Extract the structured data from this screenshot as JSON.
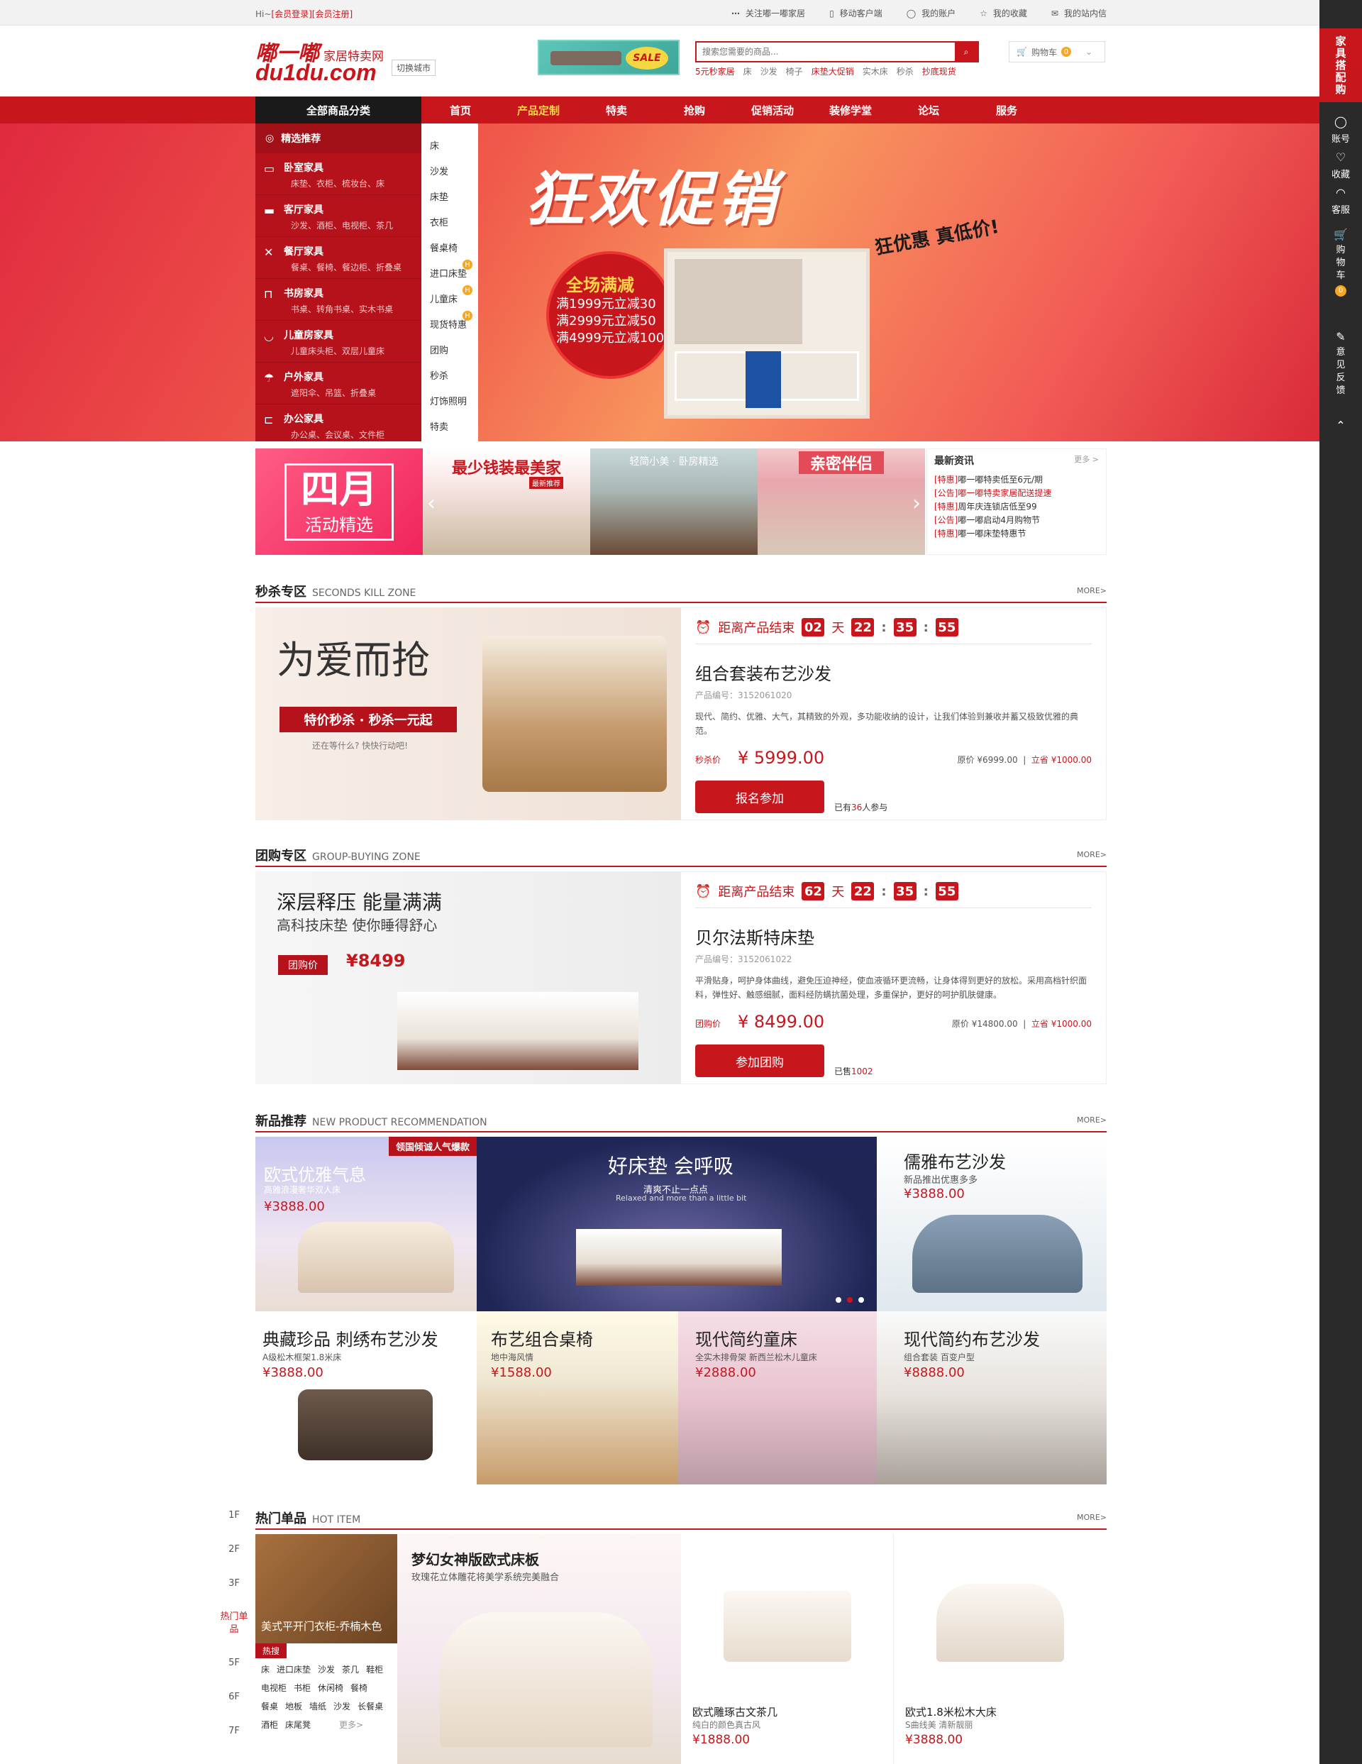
{
  "topbar": {
    "greeting_prefix": "Hi~",
    "login": "[会员登录]",
    "register": "[会员注册]",
    "links": [
      "关注嘟一嘟家居",
      "移动客户端",
      "我的账户",
      "我的收藏",
      "我的站内信"
    ]
  },
  "header": {
    "logo_cn": "嘟一嘟",
    "logo_site": "家居特卖网",
    "logo_domain": "du1du.com",
    "city_switch": "切换城市",
    "sale_badge": "SALE",
    "search_placeholder": "搜索您需要的商品...",
    "hot_words": [
      "5元秒家居",
      "床",
      "沙发",
      "椅子",
      "床垫大促销",
      "实木床",
      "秒杀",
      "抄底现货"
    ],
    "cart_label": "购物车",
    "cart_count": "0"
  },
  "nav": {
    "all_categories": "全部商品分类",
    "items": [
      "首页",
      "产品定制",
      "特卖",
      "抢购",
      "促销活动",
      "装修学堂",
      "论坛",
      "服务"
    ]
  },
  "categories": {
    "head": "精选推荐",
    "items": [
      {
        "title": "卧室家具",
        "sub": "床垫、衣柜、梳妆台、床"
      },
      {
        "title": "客厅家具",
        "sub": "沙发、酒柜、电视柜、茶几"
      },
      {
        "title": "餐厅家具",
        "sub": "餐桌、餐椅、餐边柜、折叠桌"
      },
      {
        "title": "书房家具",
        "sub": "书桌、转角书桌、实木书桌"
      },
      {
        "title": "儿童房家具",
        "sub": "儿童床头柜、双层儿童床"
      },
      {
        "title": "户外家具",
        "sub": "遮阳伞、吊篮、折叠桌"
      },
      {
        "title": "办公家具",
        "sub": "办公桌、会议桌、文件柜"
      }
    ],
    "sub_menu": [
      "床",
      "沙发",
      "床垫",
      "衣柜",
      "餐桌椅",
      "进口床垫",
      "儿童床",
      "现货特惠",
      "团购",
      "秒杀",
      "灯饰照明",
      "特卖"
    ]
  },
  "banner": {
    "title": "狂欢促销",
    "slogan": "狂优惠 真低价!",
    "promo_head": "全场满减",
    "promo_lines": [
      "满1999元立减30",
      "满2999元立减50",
      "满4999元立减100"
    ]
  },
  "sidebar": {
    "top": "家具搭配购",
    "items": [
      "账号",
      "收藏",
      "客服",
      "购物车",
      "意见反馈"
    ],
    "cart_count": "0"
  },
  "strip": {
    "april_month": "四月",
    "april_sub": "活动精选",
    "tile1": "最少钱装最美家",
    "tile1_tag": "最新推荐",
    "tile2": "轻简小美 · 卧房精选",
    "tile3": "亲密伴侣",
    "news_title": "最新资讯",
    "news_more": "更多 >",
    "news": [
      {
        "tag": "[特惠]",
        "text": "嘟一嘟特卖低至6元/期",
        "red": false
      },
      {
        "tag": "[公告]",
        "text": "嘟一嘟特卖家居配送提速",
        "red": true
      },
      {
        "tag": "[特惠]",
        "text": "周年庆连锁店低至99",
        "red": false
      },
      {
        "tag": "[公告]",
        "text": "嘟一嘟启动4月购物节",
        "red": false
      },
      {
        "tag": "[特惠]",
        "text": "嘟一嘟床垫特惠节",
        "red": false
      }
    ]
  },
  "seckill": {
    "title_zh": "秒杀专区",
    "title_en": "SECONDS KILL ZONE",
    "more": "MORE>",
    "img_title": "为爱而抢",
    "img_band": "特价秒杀 · 秒杀一元起",
    "img_note": "还在等什么? 快快行动吧!",
    "countdown_label": "距离产品结束",
    "days": "02",
    "day_unit": "天",
    "hours": "22",
    "minutes": "35",
    "seconds": "55",
    "name": "组合套装布艺沙发",
    "code": "产品编号：3152061020",
    "desc": "现代、简约、优雅、大气，其精致的外观，多功能收纳的设计，让我们体验到兼收并蓄又极致优雅的典范。",
    "price_label": "秒杀价",
    "price": "¥ 5999.00",
    "orig_label": "原价 ¥6999.00",
    "save_label": "立省 ¥1000.00",
    "button": "报名参加",
    "count_pre": "已有",
    "count_num": "36",
    "count_post": "人参与"
  },
  "group": {
    "title_zh": "团购专区",
    "title_en": "GROUP-BUYING ZONE",
    "more": "MORE>",
    "img_title": "深层释压 能量满满",
    "img_sub": "高科技床垫 使你睡得舒心",
    "img_tag": "团购价",
    "img_price": "¥8499",
    "countdown_label": "距离产品结束",
    "days": "62",
    "day_unit": "天",
    "hours": "22",
    "minutes": "35",
    "seconds": "55",
    "name": "贝尔法斯特床垫",
    "code": "产品编号：3152061022",
    "desc": "平滑贴身，呵护身体曲线，避免压迫神经，使血液循环更流畅，让身体得到更好的放松。采用高档针织面料，弹性好、触感细腻，面料经防螨抗菌处理，多重保护，更好的呵护肌肤健康。",
    "price_label": "团购价",
    "price": "¥ 8499.00",
    "orig_label": "原价 ¥14800.00",
    "save_label": "立省 ¥1000.00",
    "button": "参加团购",
    "count_pre": "已售",
    "count_num": "1002"
  },
  "newprod": {
    "title_zh": "新品推荐",
    "title_en": "NEW PRODUCT RECOMMENDATION",
    "more": "MORE>",
    "t1": {
      "title": "欧式优雅气息",
      "sub": "高雅浪漫奢华双人床",
      "price": "¥3888.00",
      "ribbon": "领国倾诚人气爆款"
    },
    "t2": {
      "title": "好床垫 会呼吸",
      "sub": "清爽不止一点点",
      "sub_en": "Relaxed and more than a little bit"
    },
    "t3": {
      "title": "儒雅布艺沙发",
      "sub": "新品推出优惠多多",
      "price": "¥3888.00"
    },
    "t4": {
      "title": "典藏珍品 刺绣布艺沙发",
      "sub": "A级松木框架1.8米床",
      "price": "¥3888.00"
    },
    "t5": {
      "title": "布艺组合桌椅",
      "sub": "地中海风情",
      "price": "¥1588.00"
    },
    "t6": {
      "title": "现代简约童床",
      "sub": "全实木排骨架 新西兰松木儿童床",
      "price": "¥2888.00"
    },
    "t7": {
      "title": "现代简约布艺沙发",
      "sub": "组合套装 百变户型",
      "price": "¥8888.00"
    }
  },
  "floors": [
    "1F",
    "2F",
    "3F",
    "热门单品",
    "5F",
    "6F",
    "7F"
  ],
  "hot": {
    "title_zh": "热门单品",
    "title_en": "HOT ITEM",
    "more": "MORE>",
    "left_title": "美式平开门衣柜-乔楠木色",
    "search_tag": "热搜",
    "keywords": [
      "床",
      "进口床垫",
      "沙发",
      "茶几",
      "鞋柜",
      "电视柜",
      "书柜",
      "休闲椅",
      "餐椅",
      "餐桌",
      "地板",
      "墙纸",
      "沙发",
      "长餐桌",
      "酒柜",
      "床尾凳"
    ],
    "keywords_more": "更多>",
    "feature_title": "梦幻女神版欧式床板",
    "feature_sub": "玫瑰花立体雕花将美学系统完美融合",
    "p1": {
      "name": "欧式雕琢古文茶几",
      "sub": "纯白的颜色真古风",
      "price": "¥1888.00"
    },
    "p2": {
      "name": "欧式1.8米松木大床",
      "sub": "S曲线美 清新靓丽",
      "price": "¥3888.00"
    }
  }
}
